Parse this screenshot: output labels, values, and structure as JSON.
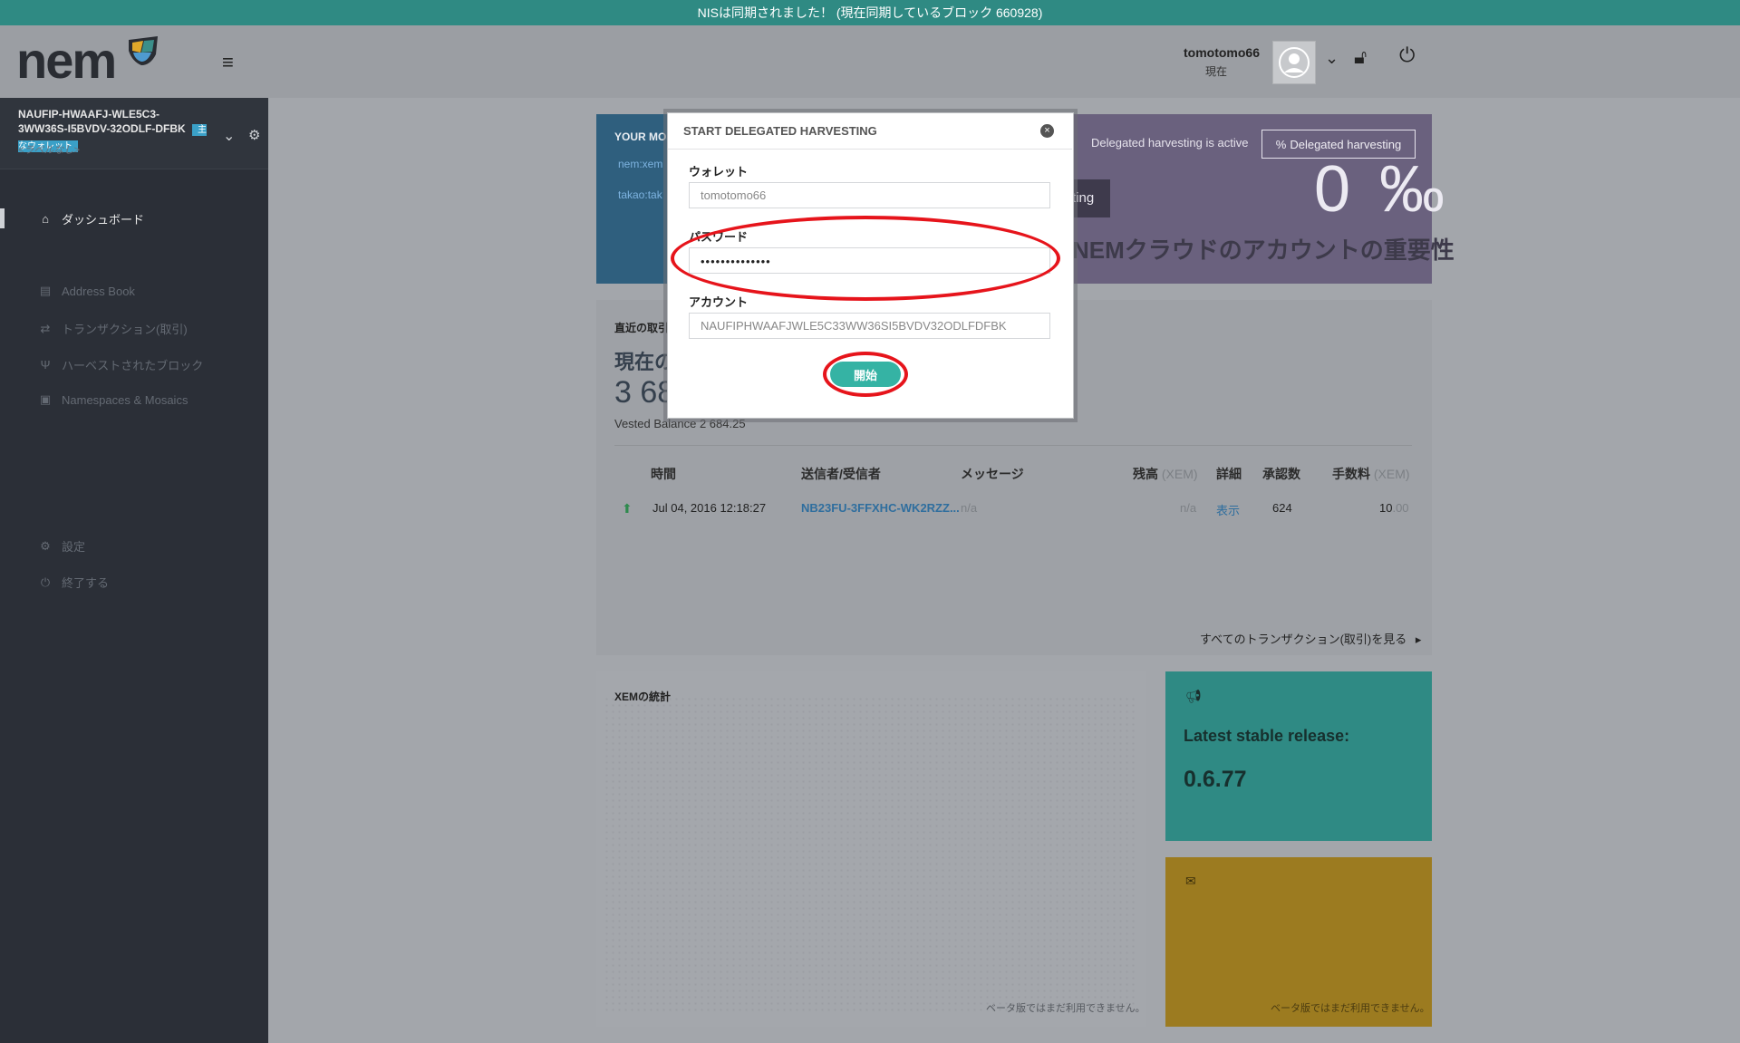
{
  "banner": {
    "text": "NISは同期されました！ (現在同期しているブロック 660928)"
  },
  "header": {
    "user_name": "tomotomo66",
    "user_status": "現在"
  },
  "logo": {
    "text": "nem"
  },
  "wallet": {
    "address": "NAUFIP-HWAAFJ-WLE5C3-3WW36S-I5BVDV-32ODLF-DFBK",
    "badge": "主なウォレット",
    "label": "<ラベルなし>"
  },
  "nav": {
    "dashboard": "ダッシュボード",
    "address_book": "Address Book",
    "transactions": "トランザクション(取引)",
    "harvested_blocks": "ハーベストされたブロック",
    "namespaces_mosaics": "Namespaces & Mosaics",
    "settings": "設定",
    "exit": "終了する"
  },
  "mosaics_panel": {
    "title": "YOUR MOS",
    "items": [
      "nem:xem",
      "takao:tak"
    ]
  },
  "harvesting_panel": {
    "status_text": "Delegated harvesting is active",
    "button_label": "Delegated harvesting",
    "start_fragment": "ting",
    "percent": "0 ‰",
    "cloud_text": "NEMクラウドのアカウントの重要性"
  },
  "transactions_panel": {
    "title": "直近の取引",
    "current_label": "現在の",
    "balance_fragment": "3 68",
    "vested": "Vested Balance 2 684.25",
    "columns": {
      "time": "時間",
      "party": "送信者/受信者",
      "message": "メッセージ",
      "balance": "残高",
      "balance_unit": "(XEM)",
      "details": "詳細",
      "confirmations": "承認数",
      "fee": "手数料",
      "fee_unit": "(XEM)"
    },
    "rows": [
      {
        "time": "Jul 04, 2016 12:18:27",
        "party": "NB23FU-3FFXHC-WK2RZZ...",
        "message": "n/a",
        "balance": "n/a",
        "details": "表示",
        "confirmations": "624",
        "fee_int": "10",
        "fee_dec": ".00"
      }
    ],
    "see_all": "すべてのトランザクション(取引)を見る"
  },
  "stats_panel": {
    "title": "XEMの統計",
    "note": "ベータ版ではまだ利用できません。"
  },
  "release_panel": {
    "title": "Latest stable release:",
    "version": "0.6.77"
  },
  "mail_panel": {
    "note": "ベータ版ではまだ利用できません。"
  },
  "modal": {
    "title": "START DELEGATED HARVESTING",
    "wallet_label": "ウォレット",
    "wallet_value": "tomotomo66",
    "password_label": "パスワード",
    "password_value": "••••••••••••••",
    "account_label": "アカウント",
    "account_value": "NAUFIPHWAAFJWLE5C33WW36SI5BVDV32ODLFDFBK",
    "start_button": "開始"
  },
  "colors": {
    "banner": "#2f8a83",
    "sidebar": "#2b2f37",
    "accent_teal": "#35b3a4",
    "annotation_red": "#e6141b",
    "purple_panel": "#6a617e",
    "gold_panel": "#9c7b20"
  },
  "icons": {
    "home": "home-icon",
    "book": "book-icon",
    "transfer": "transfer-icon",
    "harvest": "harvest-icon",
    "briefcase": "briefcase-icon",
    "gears": "gears-icon",
    "power": "power-icon",
    "lock": "unlock-icon",
    "megaphone": "megaphone-icon",
    "envelope": "envelope-icon"
  }
}
